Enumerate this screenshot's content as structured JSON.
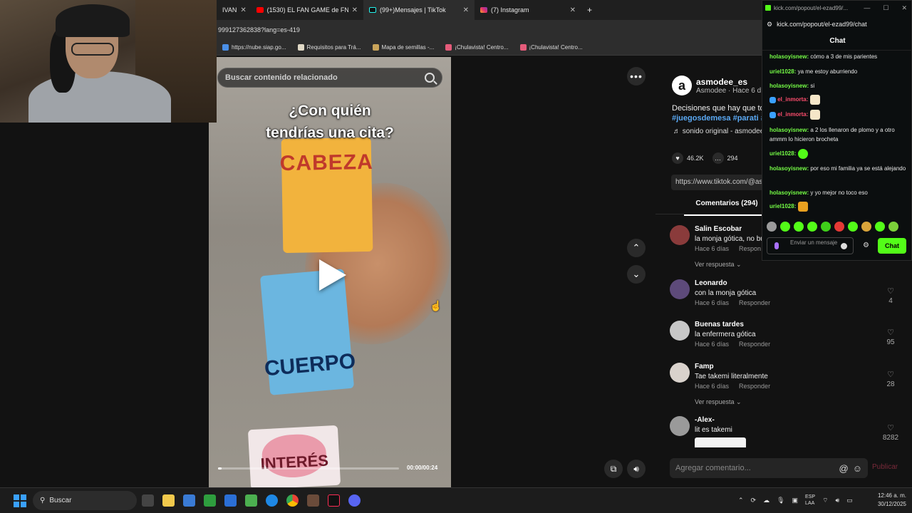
{
  "browser": {
    "tabs": [
      {
        "label": "IVAN",
        "close": "✕"
      },
      {
        "label": "(1530) EL FAN GAME de FNAF",
        "close": "✕"
      },
      {
        "label": "(99+)Mensajes | TikTok",
        "close": "✕"
      },
      {
        "label": "(7) Instagram",
        "close": "✕"
      }
    ],
    "new_tab": "+",
    "url": "999127362838?lang=es-419",
    "bookmarks": [
      {
        "label": "https://nube.siap.go...",
        "color": "#4a8fe7"
      },
      {
        "label": "Requisitos para Trá...",
        "color": "#e0d9c6"
      },
      {
        "label": "Mapa de semillas -...",
        "color": "#c9a45a"
      },
      {
        "label": "¡Chulavista! Centro...",
        "color": "#e55b7a"
      },
      {
        "label": "¡Chulavista! Centro...",
        "color": "#e55b7a"
      }
    ]
  },
  "video": {
    "search_placeholder": "Buscar contenido relacionado",
    "caption_line1": "¿Con quién",
    "caption_line2": "tendrías una cita?",
    "card_top": "CABEZA",
    "card_middle": "CUERPO",
    "card_bottom": "INTERÉS",
    "time": "00:00/00:24",
    "progress": 0.02
  },
  "post": {
    "avatar_letter": "a",
    "author": "asmodee_es",
    "author_sub": "Asmodee · Hace 6 días",
    "description": "Decisiones que hay que to",
    "hashtags": "#juegosdemesa #parati #",
    "music": "♬ sonido original - asmodee",
    "likes": "46.2K",
    "comments_count": "294",
    "link": "https://www.tiktok.com/@as",
    "comments_tab": "Comentarios (294)"
  },
  "comments": [
    {
      "name": "Salin Escobar",
      "text": "la monja gótica, no bu",
      "meta": "Hace 6 días",
      "reply": "Respon",
      "likes": "",
      "avatar_color": "#8a3b3b",
      "replies": "Ver respuesta ⌄"
    },
    {
      "name": "Leonardo",
      "text": "con la monja gótica",
      "meta": "Hace 6 días",
      "reply": "Responder",
      "likes": "4",
      "avatar_color": "#5d4a7a",
      "replies": ""
    },
    {
      "name": "Buenas tardes",
      "text": "la enfermera gótica",
      "meta": "Hace 6 días",
      "reply": "Responder",
      "likes": "95",
      "avatar_color": "#c7c7c7",
      "replies": ""
    },
    {
      "name": "Famp",
      "text": "Tae takemi literalmente",
      "meta": "Hace 6 días",
      "reply": "Responder",
      "likes": "28",
      "avatar_color": "#d9d2cc",
      "replies": "Ver respuesta ⌄"
    },
    {
      "name": "-Alex-",
      "text": "lit es takemi",
      "meta": "",
      "reply": "",
      "likes": "8282",
      "avatar_color": "#9a9a9a",
      "replies": ""
    }
  ],
  "add_comment": {
    "placeholder": "Agregar comentario...",
    "at": "@",
    "emoji": "☺",
    "publish": "Publicar"
  },
  "chat": {
    "window_url_small": "kick.com/popout/el-ezad99/...",
    "url": "kick.com/popout/el-ezad99/chat",
    "title": "Chat",
    "window_controls": [
      "—",
      "☐",
      "✕"
    ],
    "messages": [
      {
        "user": "holasoyisnew:",
        "text": " cómo a 3 de mis parientes",
        "color": "#75fd46"
      },
      {
        "user": "uriel1028:",
        "text": " ya me estoy aburriendo",
        "color": "#75fd46"
      },
      {
        "user": "holasoyisnew:",
        "text": " si",
        "color": "#75fd46"
      },
      {
        "user": "el_inmorta:",
        "text": "",
        "color": "#ff4d6d"
      },
      {
        "user": "el_inmorta:",
        "text": "",
        "color": "#ff4d6d"
      },
      {
        "user": "holasoyisnew:",
        "text": " a 2 los llenaron de plomo y a otro ammm lo hicieron brocheta",
        "color": "#75fd46"
      },
      {
        "user": "uriel1028:",
        "text": "",
        "color": "#75fd46"
      },
      {
        "user": "holasoyisnew:",
        "text": " por eso mi familia ya se está alejando",
        "color": "#75fd46"
      },
      {
        "user": "holasoyisnew:",
        "text": " y yo mejor no toco eso",
        "color": "#75fd46"
      },
      {
        "user": "uriel1028:",
        "text": "",
        "color": "#75fd46"
      }
    ],
    "input_placeholder": "Enviar un mensaje",
    "send_label": "Chat",
    "accent": "#53fc18"
  },
  "taskbar": {
    "search_label": "Buscar",
    "lang_line1": "ESP",
    "lang_line2": "LAA",
    "time": "12:46 a. m.",
    "date": "30/12/2025"
  }
}
